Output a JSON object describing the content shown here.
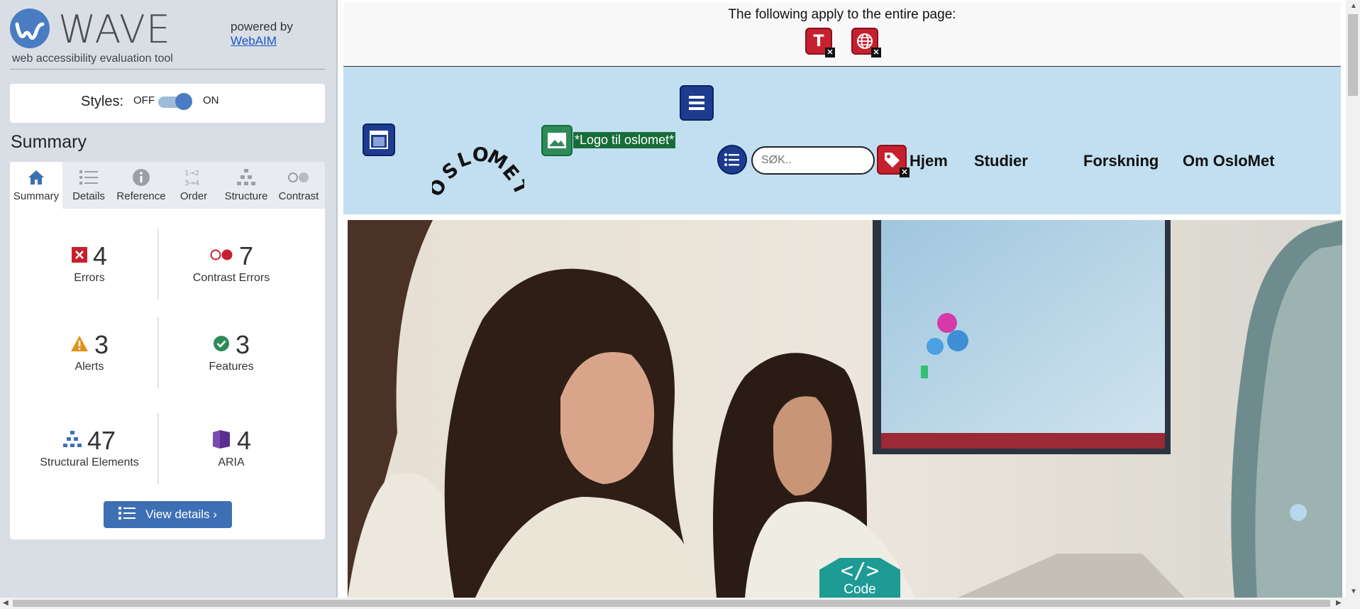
{
  "wave": {
    "logo_text": "WAVE",
    "tagline": "web accessibility evaluation tool",
    "powered_by": "powered by",
    "webaim_link": "WebAIM",
    "styles_label": "Styles:",
    "toggle_off": "OFF",
    "toggle_on": "ON",
    "summary_heading": "Summary",
    "tabs": [
      {
        "label": "Summary",
        "icon": "home-icon"
      },
      {
        "label": "Details",
        "icon": "list-icon"
      },
      {
        "label": "Reference",
        "icon": "info-icon"
      },
      {
        "label": "Order",
        "icon": "order-icon"
      },
      {
        "label": "Structure",
        "icon": "structure-icon"
      },
      {
        "label": "Contrast",
        "icon": "contrast-icon"
      }
    ],
    "order_icon_text": "1→2\n3→4",
    "stats": {
      "errors": {
        "value": "4",
        "label": "Errors"
      },
      "contrast": {
        "value": "7",
        "label": "Contrast Errors"
      },
      "alerts": {
        "value": "3",
        "label": "Alerts"
      },
      "features": {
        "value": "3",
        "label": "Features"
      },
      "structural": {
        "value": "47",
        "label": "Structural Elements"
      },
      "aria": {
        "value": "4",
        "label": "ARIA"
      }
    },
    "view_details": "View details ›",
    "colors": {
      "accent": "#4a7cc3",
      "error": "#c6202f",
      "alert": "#e0931a",
      "feature": "#2e8b57",
      "aria": "#5b2d8e"
    }
  },
  "page": {
    "apply_text": "The following apply to the entire page:",
    "logo_alt": "*Logo til oslomet*",
    "logo_letters": "OSLOMET",
    "search_placeholder": "SØK..",
    "nav": [
      "Hjem",
      "Studier",
      "Forskning",
      "Om OsloMet"
    ],
    "code_label": "Code",
    "code_symbol": "</>"
  }
}
